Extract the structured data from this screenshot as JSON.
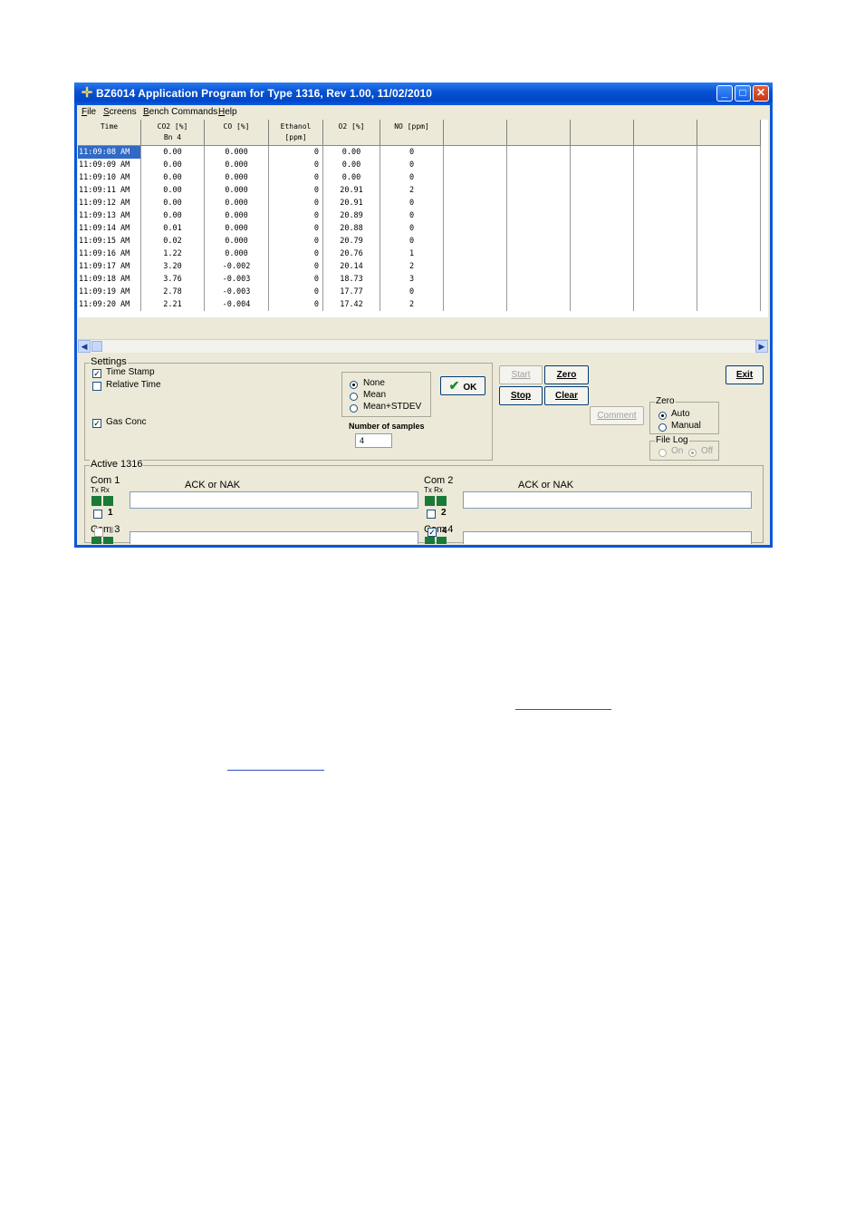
{
  "window": {
    "title": "BZ6014 Application Program for Type 1316, Rev 1.00, 11/02/2010",
    "controls": {
      "minimize": "_",
      "maximize": "□",
      "close": "✕"
    }
  },
  "menu": [
    "File",
    "Screens",
    "Bench Commands",
    "Help"
  ],
  "grid": {
    "headers": [
      {
        "l1": "Time",
        "l2": ""
      },
      {
        "l1": "CO2 [%]",
        "l2": "Bn 4"
      },
      {
        "l1": "CO [%]",
        "l2": ""
      },
      {
        "l1": "Ethanol",
        "l2": "[ppm]"
      },
      {
        "l1": "O2 [%]",
        "l2": ""
      },
      {
        "l1": "NO [ppm]",
        "l2": ""
      },
      {
        "l1": "",
        "l2": ""
      },
      {
        "l1": "",
        "l2": ""
      },
      {
        "l1": "",
        "l2": ""
      },
      {
        "l1": "",
        "l2": ""
      },
      {
        "l1": "",
        "l2": ""
      }
    ],
    "rows": [
      [
        "11:09:08 AM",
        "0.00",
        "0.000",
        "0",
        "0.00",
        "0"
      ],
      [
        "11:09:09 AM",
        "0.00",
        "0.000",
        "0",
        "0.00",
        "0"
      ],
      [
        "11:09:10 AM",
        "0.00",
        "0.000",
        "0",
        "0.00",
        "0"
      ],
      [
        "11:09:11 AM",
        "0.00",
        "0.000",
        "0",
        "20.91",
        "2"
      ],
      [
        "11:09:12 AM",
        "0.00",
        "0.000",
        "0",
        "20.91",
        "0"
      ],
      [
        "11:09:13 AM",
        "0.00",
        "0.000",
        "0",
        "20.89",
        "0"
      ],
      [
        "11:09:14 AM",
        "0.01",
        "0.000",
        "0",
        "20.88",
        "0"
      ],
      [
        "11:09:15 AM",
        "0.02",
        "0.000",
        "0",
        "20.79",
        "0"
      ],
      [
        "11:09:16 AM",
        "1.22",
        "0.000",
        "0",
        "20.76",
        "1"
      ],
      [
        "11:09:17 AM",
        "3.20",
        "-0.002",
        "0",
        "20.14",
        "2"
      ],
      [
        "11:09:18 AM",
        "3.76",
        "-0.003",
        "0",
        "18.73",
        "3"
      ],
      [
        "11:09:19 AM",
        "2.78",
        "-0.003",
        "0",
        "17.77",
        "0"
      ],
      [
        "11:09:20 AM",
        "2.21",
        "-0.004",
        "0",
        "17.42",
        "2"
      ]
    ]
  },
  "settings": {
    "title": "Settings",
    "time_stamp": "Time Stamp",
    "relative_time": "Relative Time",
    "gas_conc": "Gas Conc",
    "stat_options": [
      "None",
      "Mean",
      "Mean+STDEV"
    ],
    "ok": "OK",
    "num_samples_label": "Number of samples",
    "num_samples_value": "4"
  },
  "buttons": {
    "start": "Start",
    "zero": "Zero",
    "stop": "Stop",
    "clear": "Clear",
    "comment": "Comment",
    "exit": "Exit"
  },
  "zero_group": {
    "title": "Zero",
    "auto": "Auto",
    "manual": "Manual"
  },
  "file_log": {
    "title": "File Log",
    "on": "On",
    "off": "Off"
  },
  "active": {
    "title": "Active 1316",
    "txrx": "Tx Rx",
    "ack": "ACK or  NAK",
    "coms": [
      {
        "name": "Com 1",
        "num": "1"
      },
      {
        "name": "Com 2",
        "num": "2"
      },
      {
        "name": "Com 3",
        "num": "3"
      },
      {
        "name": "Com 4",
        "num": "4"
      }
    ],
    "checkmark": "✓"
  }
}
